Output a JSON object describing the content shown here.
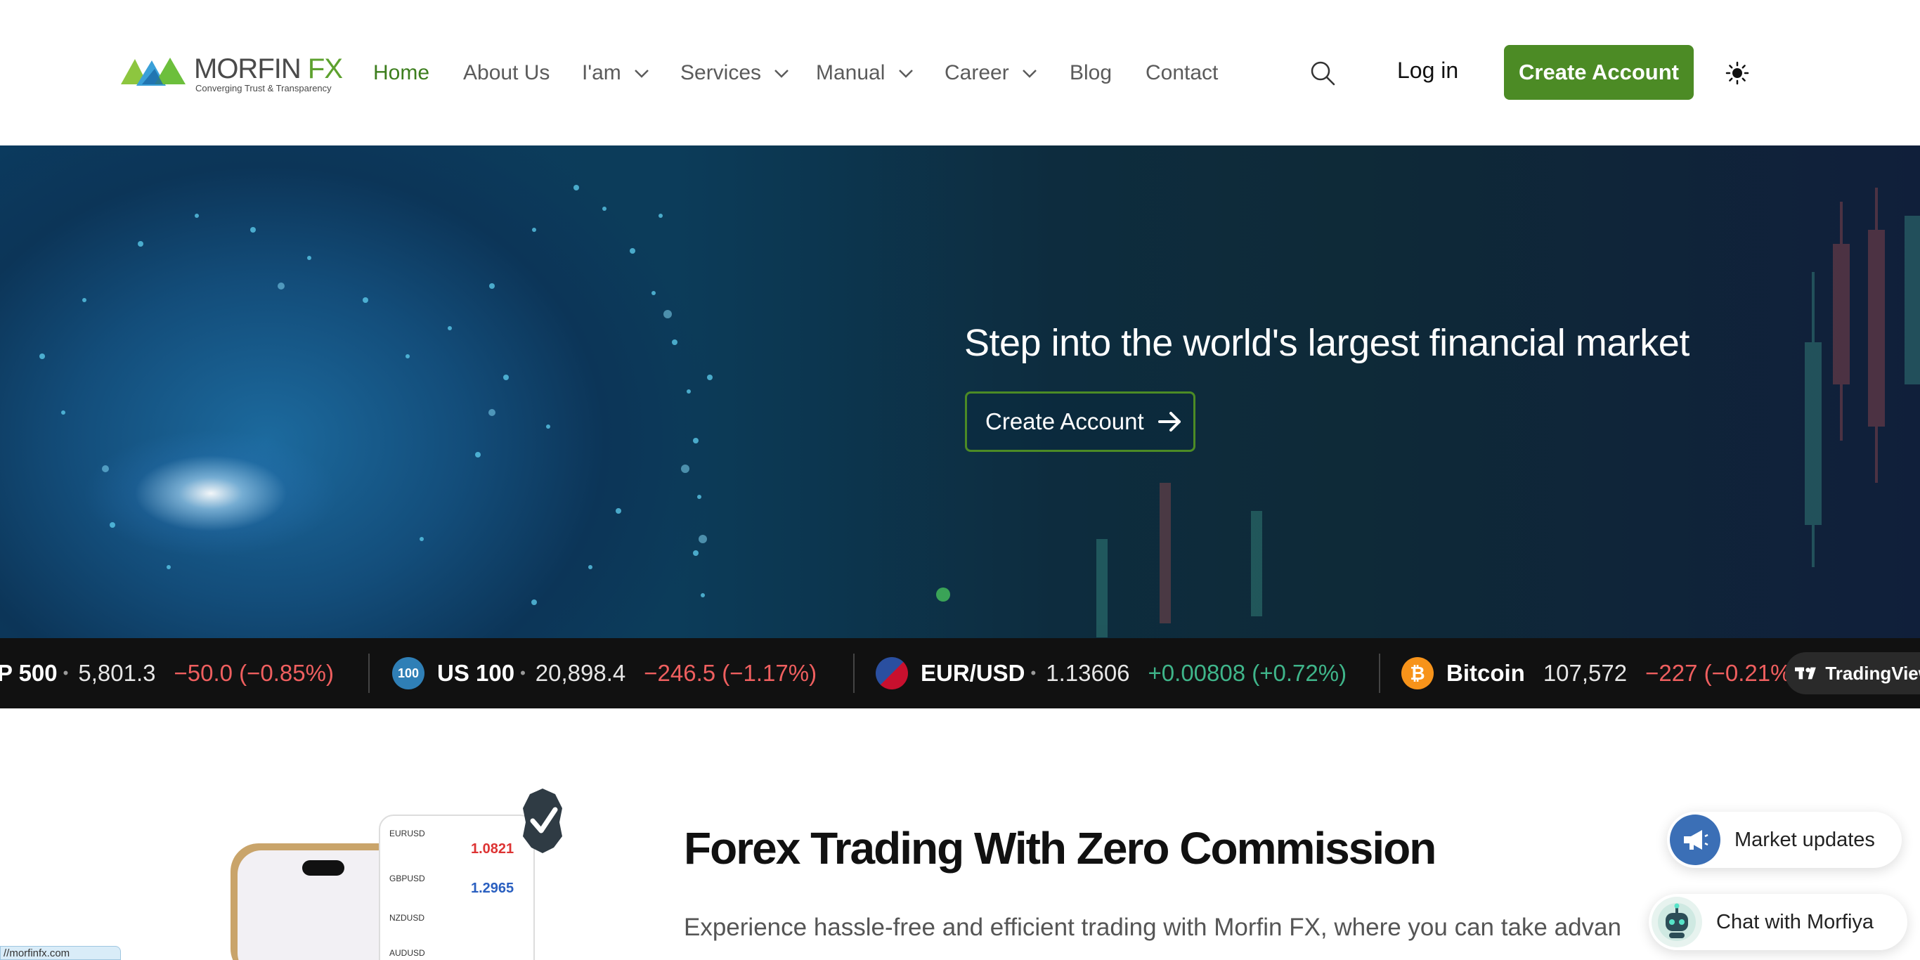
{
  "brand": {
    "name_main": "MORFIN",
    "name_accent": " FX",
    "tagline": "Converging Trust & Transparency",
    "accent_color": "#4c8b25"
  },
  "nav": {
    "items": [
      {
        "label": "Home",
        "active": true
      },
      {
        "label": "About Us"
      },
      {
        "label": "I'am",
        "dropdown": true
      },
      {
        "label": "Services",
        "dropdown": true
      },
      {
        "label": "Manual",
        "dropdown": true
      },
      {
        "label": "Career",
        "dropdown": true
      },
      {
        "label": "Blog"
      },
      {
        "label": "Contact"
      }
    ],
    "search_icon": "search-icon",
    "login_label": "Log in",
    "create_account_label": "Create Account",
    "theme_icon": "sun-icon"
  },
  "hero": {
    "title": "Step into the world's largest financial market",
    "button_label": "Create Account",
    "slide_dots": 1
  },
  "ticker": {
    "items": [
      {
        "name": "P 500",
        "value": "5,801.3",
        "change": "−50.0 (−0.85%)",
        "direction": "neg"
      },
      {
        "name": "US 100",
        "icon_text": "100",
        "value": "20,898.4",
        "change": "−246.5 (−1.17%)",
        "direction": "neg"
      },
      {
        "name": "EUR/USD",
        "value": "1.13606",
        "change": "+0.00808 (+0.72%)",
        "direction": "pos"
      },
      {
        "name": "Bitcoin",
        "icon_text": "₿",
        "value": "107,572",
        "change": "−227 (−0.21%)",
        "direction": "neg"
      }
    ],
    "badge_label": "TradingView"
  },
  "section": {
    "title": "Forex Trading With Zero Commission",
    "text": "Experience hassle-free and efficient trading with Morfin FX, where you can take advan"
  },
  "widgets": {
    "market_updates_label": "Market updates",
    "chat_label": "Chat with Morfiya"
  },
  "status_url": "//morfinfx.com"
}
